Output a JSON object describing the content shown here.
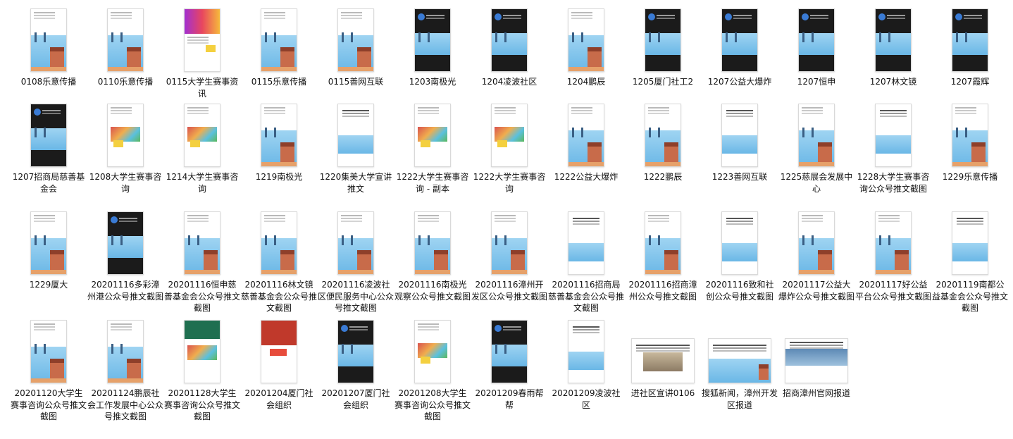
{
  "files": [
    {
      "name": "0108乐意传播",
      "thumb": "comic"
    },
    {
      "name": "0110乐意传播",
      "thumb": "comic"
    },
    {
      "name": "0115大学生赛事资讯",
      "thumb": "gradient"
    },
    {
      "name": "0115乐意传播",
      "thumb": "comic"
    },
    {
      "name": "0115善网互联",
      "thumb": "comic"
    },
    {
      "name": "1203南极光",
      "thumb": "dark"
    },
    {
      "name": "1204凌波社区",
      "thumb": "dark"
    },
    {
      "name": "1204鹏辰",
      "thumb": "comic"
    },
    {
      "name": "1205厦门社工2",
      "thumb": "dark"
    },
    {
      "name": "1207公益大爆炸",
      "thumb": "dark"
    },
    {
      "name": "1207恒申",
      "thumb": "dark"
    },
    {
      "name": "1207林文镜",
      "thumb": "dark"
    },
    {
      "name": "1207霞辉",
      "thumb": "dark"
    },
    {
      "name": "1207招商局慈善基金会",
      "thumb": "dark"
    },
    {
      "name": "1208大学生赛事咨询",
      "thumb": "colorful"
    },
    {
      "name": "1214大学生赛事咨询",
      "thumb": "colorful"
    },
    {
      "name": "1219南极光",
      "thumb": "comic"
    },
    {
      "name": "1220集美大学宣讲推文",
      "thumb": "news"
    },
    {
      "name": "1222大学生赛事咨询 - 副本",
      "thumb": "colorful"
    },
    {
      "name": "1222大学生赛事咨询",
      "thumb": "colorful"
    },
    {
      "name": "1222公益大爆炸",
      "thumb": "comic"
    },
    {
      "name": "1222鹏辰",
      "thumb": "comic"
    },
    {
      "name": "1223善网互联",
      "thumb": "news"
    },
    {
      "name": "1225慈展会发展中心",
      "thumb": "comic"
    },
    {
      "name": "1228大学生赛事咨询公众号推文截图",
      "thumb": "news"
    },
    {
      "name": "1229乐意传播",
      "thumb": "comic"
    },
    {
      "name": "1229厦大",
      "thumb": "comic"
    },
    {
      "name": "20201116多彩漳州港公众号推文截图",
      "thumb": "dark"
    },
    {
      "name": "20201116恒申慈善基金会公众号推文截图",
      "thumb": "comic"
    },
    {
      "name": "20201116林文镜慈善基金会公众号推文截图",
      "thumb": "comic"
    },
    {
      "name": "20201116凌波社区便民服务中心公众号推文截图",
      "thumb": "comic"
    },
    {
      "name": "20201116南极光观察公众号推文截图",
      "thumb": "comic"
    },
    {
      "name": "20201116漳州开发区公众号推文截图",
      "thumb": "comic"
    },
    {
      "name": "20201116招商局慈善基金会公众号推文截图",
      "thumb": "news"
    },
    {
      "name": "20201116招商漳州公众号推文截图",
      "thumb": "comic"
    },
    {
      "name": "20201116致和社创公众号推文截图",
      "thumb": "news"
    },
    {
      "name": "20201117公益大爆炸公众号推文截图",
      "thumb": "comic"
    },
    {
      "name": "20201117好公益平台公众号推文截图",
      "thumb": "comic"
    },
    {
      "name": "20201119南都公益基金会公众号推文截图",
      "thumb": "news"
    },
    {
      "name": "20201120大学生赛事咨询公众号推文截图",
      "thumb": "comic"
    },
    {
      "name": "20201124鹏辰社会工作发展中心公众号推文截图",
      "thumb": "comic"
    },
    {
      "name": "20201128大学生赛事咨询公众号推文截图",
      "thumb": "green"
    },
    {
      "name": "20201204厦门社会组织",
      "thumb": "red"
    },
    {
      "name": "20201207厦门社会组织",
      "thumb": "dark"
    },
    {
      "name": "20201208大学生赛事咨询公众号推文截图",
      "thumb": "colorful"
    },
    {
      "name": "20201209春雨帮帮",
      "thumb": "dark"
    },
    {
      "name": "20201209凌波社区",
      "thumb": "news"
    },
    {
      "name": "进社区宣讲0106",
      "thumb": "photo"
    },
    {
      "name": "搜狐新闻，漳州开发区报道",
      "thumb": "webcomic"
    },
    {
      "name": "招商漳州官网报道",
      "thumb": "sea"
    }
  ]
}
